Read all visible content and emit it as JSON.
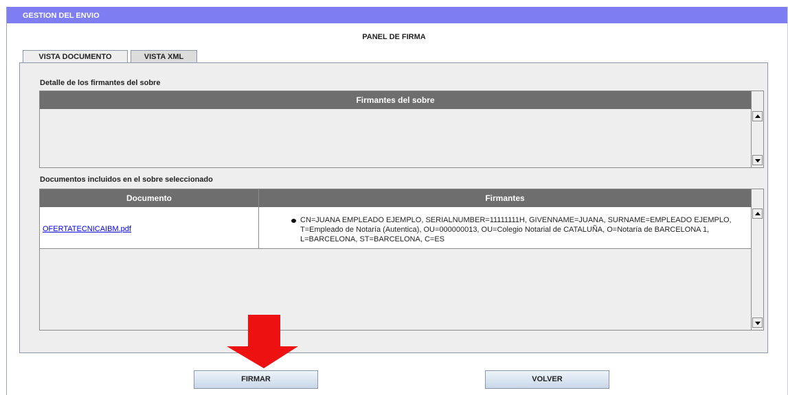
{
  "window": {
    "title": "GESTION DEL ENVIO"
  },
  "panel": {
    "title": "PANEL DE FIRMA"
  },
  "tabs": [
    {
      "label": "VISTA DOCUMENTO",
      "active": true
    },
    {
      "label": "VISTA XML",
      "active": false
    }
  ],
  "signers_section": {
    "label": "Detalle de los firmantes del sobre",
    "column_header": "Firmantes del sobre"
  },
  "documents_section": {
    "label": "Documentos incluidos en el sobre seleccionado",
    "columns": [
      "Documento",
      "Firmantes"
    ],
    "rows": [
      {
        "document": "OFERTATECNICAIBM.pdf",
        "signers": "CN=JUANA EMPLEADO EJEMPLO, SERIALNUMBER=11111111H, GIVENNAME=JUANA, SURNAME=EMPLEADO EJEMPLO, T=Empleado de Notaría (Autentica), OU=000000013, OU=Colegio Notarial de CATALUÑA, O=Notaría de BARCELONA 1, L=BARCELONA, ST=BARCELONA, C=ES"
      }
    ]
  },
  "buttons": {
    "sign": "FIRMAR",
    "back": "VOLVER"
  },
  "colors": {
    "titlebar": "#7e7ef2",
    "table_header": "#6e6e6e",
    "arrow": "#ee1111",
    "link": "#0000e6"
  },
  "icons": [
    "arrow-up-icon",
    "arrow-down-icon",
    "bullet-icon",
    "red-down-arrow-icon"
  ]
}
